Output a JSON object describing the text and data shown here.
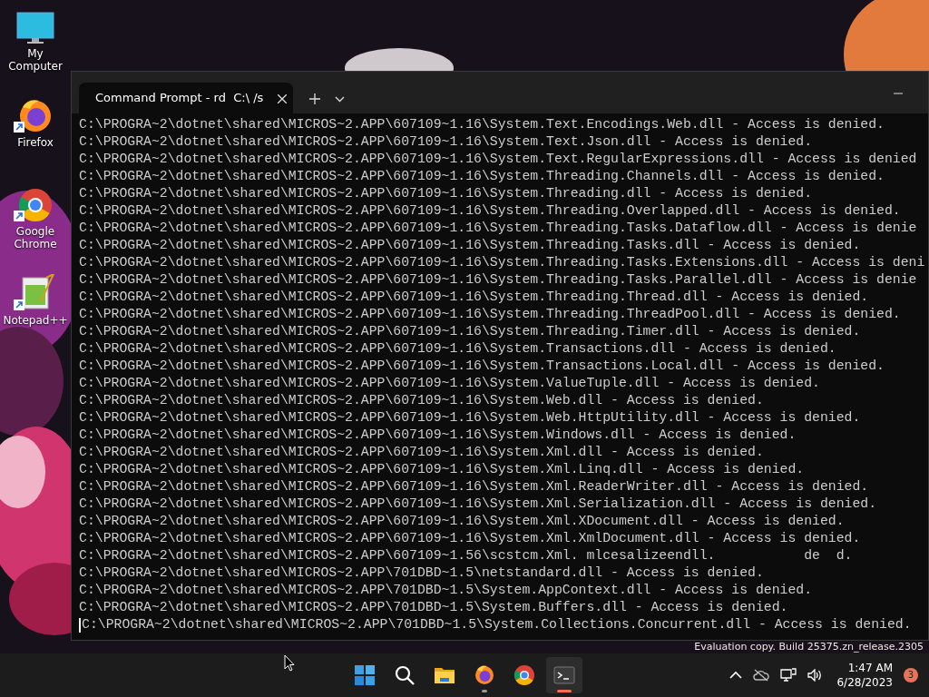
{
  "desktop_icons": [
    {
      "kind": "computer",
      "label": "My Computer",
      "shortcut": false
    },
    {
      "kind": "firefox",
      "label": "Firefox",
      "shortcut": true
    },
    {
      "kind": "chrome",
      "label": "Google Chrome",
      "shortcut": true
    },
    {
      "kind": "notepad",
      "label": "Notepad++",
      "shortcut": true
    }
  ],
  "terminal": {
    "tabs": [
      {
        "title": "Command Prompt - rd  C:\\ /s",
        "selected": true
      }
    ],
    "lines": [
      "C:\\PROGRA~2\\dotnet\\shared\\MICROS~2.APP\\607109~1.16\\System.Text.Encodings.Web.dll - Access is denied.",
      "C:\\PROGRA~2\\dotnet\\shared\\MICROS~2.APP\\607109~1.16\\System.Text.Json.dll - Access is denied.",
      "C:\\PROGRA~2\\dotnet\\shared\\MICROS~2.APP\\607109~1.16\\System.Text.RegularExpressions.dll - Access is denied",
      "C:\\PROGRA~2\\dotnet\\shared\\MICROS~2.APP\\607109~1.16\\System.Threading.Channels.dll - Access is denied.",
      "C:\\PROGRA~2\\dotnet\\shared\\MICROS~2.APP\\607109~1.16\\System.Threading.dll - Access is denied.",
      "C:\\PROGRA~2\\dotnet\\shared\\MICROS~2.APP\\607109~1.16\\System.Threading.Overlapped.dll - Access is denied.",
      "C:\\PROGRA~2\\dotnet\\shared\\MICROS~2.APP\\607109~1.16\\System.Threading.Tasks.Dataflow.dll - Access is denie",
      "C:\\PROGRA~2\\dotnet\\shared\\MICROS~2.APP\\607109~1.16\\System.Threading.Tasks.dll - Access is denied.",
      "C:\\PROGRA~2\\dotnet\\shared\\MICROS~2.APP\\607109~1.16\\System.Threading.Tasks.Extensions.dll - Access is deni",
      "C:\\PROGRA~2\\dotnet\\shared\\MICROS~2.APP\\607109~1.16\\System.Threading.Tasks.Parallel.dll - Access is denie",
      "C:\\PROGRA~2\\dotnet\\shared\\MICROS~2.APP\\607109~1.16\\System.Threading.Thread.dll - Access is denied.",
      "C:\\PROGRA~2\\dotnet\\shared\\MICROS~2.APP\\607109~1.16\\System.Threading.ThreadPool.dll - Access is denied.",
      "C:\\PROGRA~2\\dotnet\\shared\\MICROS~2.APP\\607109~1.16\\System.Threading.Timer.dll - Access is denied.",
      "C:\\PROGRA~2\\dotnet\\shared\\MICROS~2.APP\\607109~1.16\\System.Transactions.dll - Access is denied.",
      "C:\\PROGRA~2\\dotnet\\shared\\MICROS~2.APP\\607109~1.16\\System.Transactions.Local.dll - Access is denied.",
      "C:\\PROGRA~2\\dotnet\\shared\\MICROS~2.APP\\607109~1.16\\System.ValueTuple.dll - Access is denied.",
      "C:\\PROGRA~2\\dotnet\\shared\\MICROS~2.APP\\607109~1.16\\System.Web.dll - Access is denied.",
      "C:\\PROGRA~2\\dotnet\\shared\\MICROS~2.APP\\607109~1.16\\System.Web.HttpUtility.dll - Access is denied.",
      "C:\\PROGRA~2\\dotnet\\shared\\MICROS~2.APP\\607109~1.16\\System.Windows.dll - Access is denied.",
      "C:\\PROGRA~2\\dotnet\\shared\\MICROS~2.APP\\607109~1.16\\System.Xml.dll - Access is denied.",
      "C:\\PROGRA~2\\dotnet\\shared\\MICROS~2.APP\\607109~1.16\\System.Xml.Linq.dll - Access is denied.",
      "C:\\PROGRA~2\\dotnet\\shared\\MICROS~2.APP\\607109~1.16\\System.Xml.ReaderWriter.dll - Access is denied.",
      "C:\\PROGRA~2\\dotnet\\shared\\MICROS~2.APP\\607109~1.16\\System.Xml.Serialization.dll - Access is denied.",
      "C:\\PROGRA~2\\dotnet\\shared\\MICROS~2.APP\\607109~1.16\\System.Xml.XDocument.dll - Access is denied.",
      "C:\\PROGRA~2\\dotnet\\shared\\MICROS~2.APP\\607109~1.16\\System.Xml.XmlDocument.dll - Access is denied.",
      "C:\\PROGRA~2\\dotnet\\shared\\MICROS~2.APP\\607109~1.56\\scstcm.Xml. mlcesalizeendll.           de  d.",
      "C:\\PROGRA~2\\dotnet\\shared\\MICROS~2.APP\\701DBD~1.5\\netstandard.dll - Access is denied.",
      "C:\\PROGRA~2\\dotnet\\shared\\MICROS~2.APP\\701DBD~1.5\\System.AppContext.dll - Access is denied.",
      "C:\\PROGRA~2\\dotnet\\shared\\MICROS~2.APP\\701DBD~1.5\\System.Buffers.dll - Access is denied.",
      "C:\\PROGRA~2\\dotnet\\shared\\MICROS~2.APP\\701DBD~1.5\\System.Collections.Concurrent.dll - Access is denied."
    ],
    "cursor_visible": true
  },
  "desktop_notice": "Evaluation copy. Build 25375.zn_release.2305",
  "taskbar": {
    "apps": [
      {
        "kind": "start",
        "running": false,
        "focused": false
      },
      {
        "kind": "search",
        "running": false,
        "focused": false
      },
      {
        "kind": "folder",
        "running": false,
        "focused": false
      },
      {
        "kind": "firefox",
        "running": true,
        "focused": false
      },
      {
        "kind": "chrome",
        "running": false,
        "focused": false
      },
      {
        "kind": "terminal",
        "running": true,
        "focused": true
      }
    ],
    "clock": {
      "time": "1:47 AM",
      "date": "6/28/2023"
    },
    "notification_count": "3"
  }
}
